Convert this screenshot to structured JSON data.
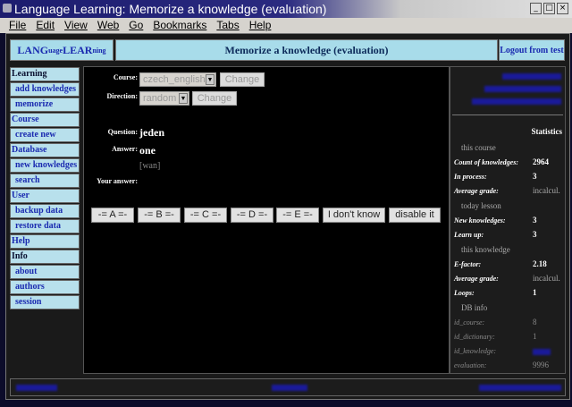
{
  "window": {
    "title": "Language Learning: Memorize a knowledge (evaluation)"
  },
  "menu": [
    "File",
    "Edit",
    "View",
    "Web",
    "Go",
    "Bookmarks",
    "Tabs",
    "Help"
  ],
  "header": {
    "logo": {
      "a": "LANG",
      "b": "uage",
      "c": "LEAR",
      "d": "ning"
    },
    "title": "Memorize a knowledge (evaluation)",
    "logout": "Logout from test"
  },
  "sidebar": [
    {
      "label": "Learning",
      "type": "heading-dark"
    },
    {
      "label": "add knowledges",
      "type": "sub"
    },
    {
      "label": "memorize",
      "type": "sub"
    },
    {
      "label": "Course",
      "type": "heading"
    },
    {
      "label": "create new",
      "type": "sub"
    },
    {
      "label": "Database",
      "type": "heading"
    },
    {
      "label": "new knowledges",
      "type": "sub"
    },
    {
      "label": "search",
      "type": "sub"
    },
    {
      "label": "User",
      "type": "heading"
    },
    {
      "label": "backup data",
      "type": "sub"
    },
    {
      "label": "restore data",
      "type": "sub"
    },
    {
      "label": "Help",
      "type": "heading"
    },
    {
      "label": "Info",
      "type": "heading-dark"
    },
    {
      "label": "about",
      "type": "sub"
    },
    {
      "label": "authors",
      "type": "sub"
    },
    {
      "label": "session",
      "type": "sub"
    }
  ],
  "main": {
    "course_label": "Course:",
    "course_value": "czech_english",
    "change": "Change",
    "direction_label": "Direction:",
    "direction_value": "random",
    "question_label": "Question:",
    "question": "jeden",
    "answer_label": "Answer:",
    "answer": "one",
    "pronunciation": "[wan]",
    "your_answer_label": "Your answer:",
    "buttons": [
      "-= A =-",
      "-= B =-",
      "-= C =-",
      "-= D =-",
      "-= E =-",
      "I don't know",
      "disable it"
    ]
  },
  "stats": {
    "title": "Statistics",
    "course_head": "this course",
    "count_label": "Count of knowledges:",
    "count": "2964",
    "inprocess_label": "In process:",
    "inprocess": "3",
    "avg_label": "Average grade:",
    "avg": "incalcul.",
    "today_head": "today lesson",
    "new_label": "New knowledges:",
    "new": "3",
    "learnup_label": "Learn up:",
    "learnup": "3",
    "knowledge_head": "this knowledge",
    "efactor_label": "E-factor:",
    "efactor": "2.18",
    "kavg_label": "Average grade:",
    "kavg": "incalcul.",
    "loops_label": "Loops:",
    "loops": "1",
    "db_head": "DB info",
    "idc_label": "id_course:",
    "idc": "8",
    "idd_label": "id_dictionary:",
    "idd": "1",
    "idk_label": "id_knowledge:",
    "ev_label": "evaluation:",
    "ev": "9996"
  },
  "colors": {
    "header_bg": "#a8dcea",
    "link": "#1a2ab0",
    "page_bg": "#1a1a1a"
  }
}
